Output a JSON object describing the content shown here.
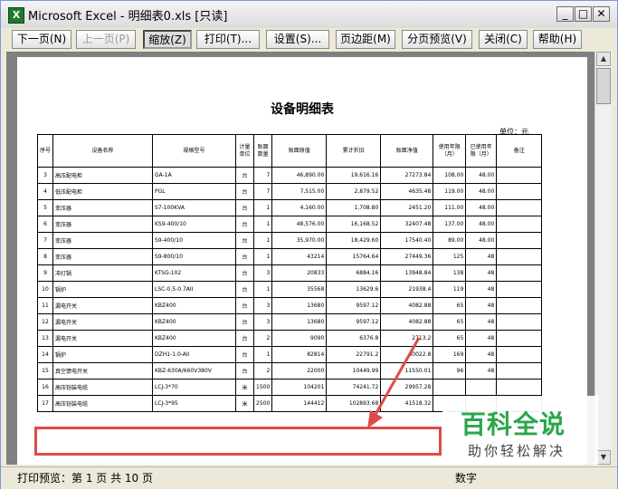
{
  "window": {
    "title": "Microsoft Excel - 明细表0.xls  [只读]",
    "app_icon": "excel-icon",
    "controls": {
      "minimize": "_",
      "maximize": "□",
      "close": "✕"
    }
  },
  "toolbar": {
    "buttons": [
      {
        "label": "下一页(N)",
        "state": "enabled"
      },
      {
        "label": "上一页(P)",
        "state": "disabled"
      },
      {
        "label": "缩放(Z)",
        "state": "pressed"
      },
      {
        "label": "打印(T)...",
        "state": "enabled"
      },
      {
        "label": "设置(S)...",
        "state": "enabled"
      },
      {
        "label": "页边距(M)",
        "state": "enabled"
      },
      {
        "label": "分页预览(V)",
        "state": "enabled"
      },
      {
        "label": "关闭(C)",
        "state": "enabled"
      },
      {
        "label": "帮助(H)",
        "state": "enabled"
      }
    ]
  },
  "sheet": {
    "title": "设备明细表",
    "unit": "单位：元",
    "headers": [
      "序号",
      "设备名称",
      "规格型号",
      "计量单位",
      "账面数量",
      "账面原值",
      "累计折旧",
      "账面净值",
      "使用年限（月）",
      "已使用年限（月）",
      "备注"
    ],
    "rows": [
      [
        "3",
        "高压配电柜",
        "GA-1A",
        "台",
        "7",
        "46,890.00",
        "19,616.16",
        "27273.84",
        "108.00",
        "48.00",
        ""
      ],
      [
        "4",
        "低压配电柜",
        "PGL",
        "台",
        "7",
        "7,515.00",
        "2,879.52",
        "4635.48",
        "119.00",
        "48.00",
        ""
      ],
      [
        "5",
        "变压器",
        "S7-100KVA",
        "台",
        "1",
        "4,160.00",
        "1,708.80",
        "2451.20",
        "111.00",
        "48.00",
        ""
      ],
      [
        "6",
        "变压器",
        "KS9-400/10",
        "台",
        "1",
        "48,576.00",
        "16,168.52",
        "32407.48",
        "137.00",
        "48.00",
        ""
      ],
      [
        "7",
        "变压器",
        "S9-400/10",
        "台",
        "1",
        "35,970.00",
        "18,429.60",
        "17540.40",
        "89.00",
        "48.00",
        ""
      ],
      [
        "8",
        "变压器",
        "S9-800/10",
        "台",
        "1",
        "43214",
        "15764.64",
        "27449.36",
        "125",
        "48",
        ""
      ],
      [
        "9",
        "冲灯锅",
        "KTSG-102",
        "台",
        "3",
        "20833",
        "6884.16",
        "13948.84",
        "138",
        "48",
        ""
      ],
      [
        "10",
        "锅炉",
        "LSC-0.5-0.7AII",
        "台",
        "1",
        "35568",
        "13629.6",
        "21938.4",
        "119",
        "48",
        ""
      ],
      [
        "11",
        "漏电开关",
        "KBZ400",
        "台",
        "3",
        "13680",
        "9597.12",
        "4082.88",
        "65",
        "48",
        ""
      ],
      [
        "12",
        "漏电开关",
        "KBZ400",
        "台",
        "3",
        "13680",
        "9597.12",
        "4082.88",
        "65",
        "48",
        ""
      ],
      [
        "13",
        "漏电开关",
        "KBZ400",
        "台",
        "2",
        "9090",
        "6376.8",
        "2713.2",
        "65",
        "48",
        ""
      ],
      [
        "14",
        "锅炉",
        "DZH1-1.0-AII",
        "台",
        "1",
        "82814",
        "22791.2",
        "60022.8",
        "169",
        "48",
        ""
      ],
      [
        "15",
        "真空馈电开关",
        "KBZ-630A/660V380V",
        "台",
        "2",
        "22000",
        "10449.99",
        "11550.01",
        "96",
        "48",
        ""
      ],
      [
        "16",
        "高压铠装电缆",
        "LCJ-3*70",
        "米",
        "1500",
        "104201",
        "74241.72",
        "29957.28",
        "",
        "",
        ""
      ],
      [
        "17",
        "高压铠装电缆",
        "LCJ-3*95",
        "米",
        "2500",
        "144412",
        "102893.68",
        "41518.32",
        "",
        "",
        ""
      ]
    ]
  },
  "statusbar": {
    "left": "打印预览：第 1 页  共 10 页",
    "right": "数字"
  },
  "watermark": {
    "main": "百科全说",
    "sub": "助你轻松解决"
  },
  "colors": {
    "annotation_red": "#e04a4a",
    "watermark_green": "#2aa64a",
    "window_bg": "#ece9d8"
  }
}
